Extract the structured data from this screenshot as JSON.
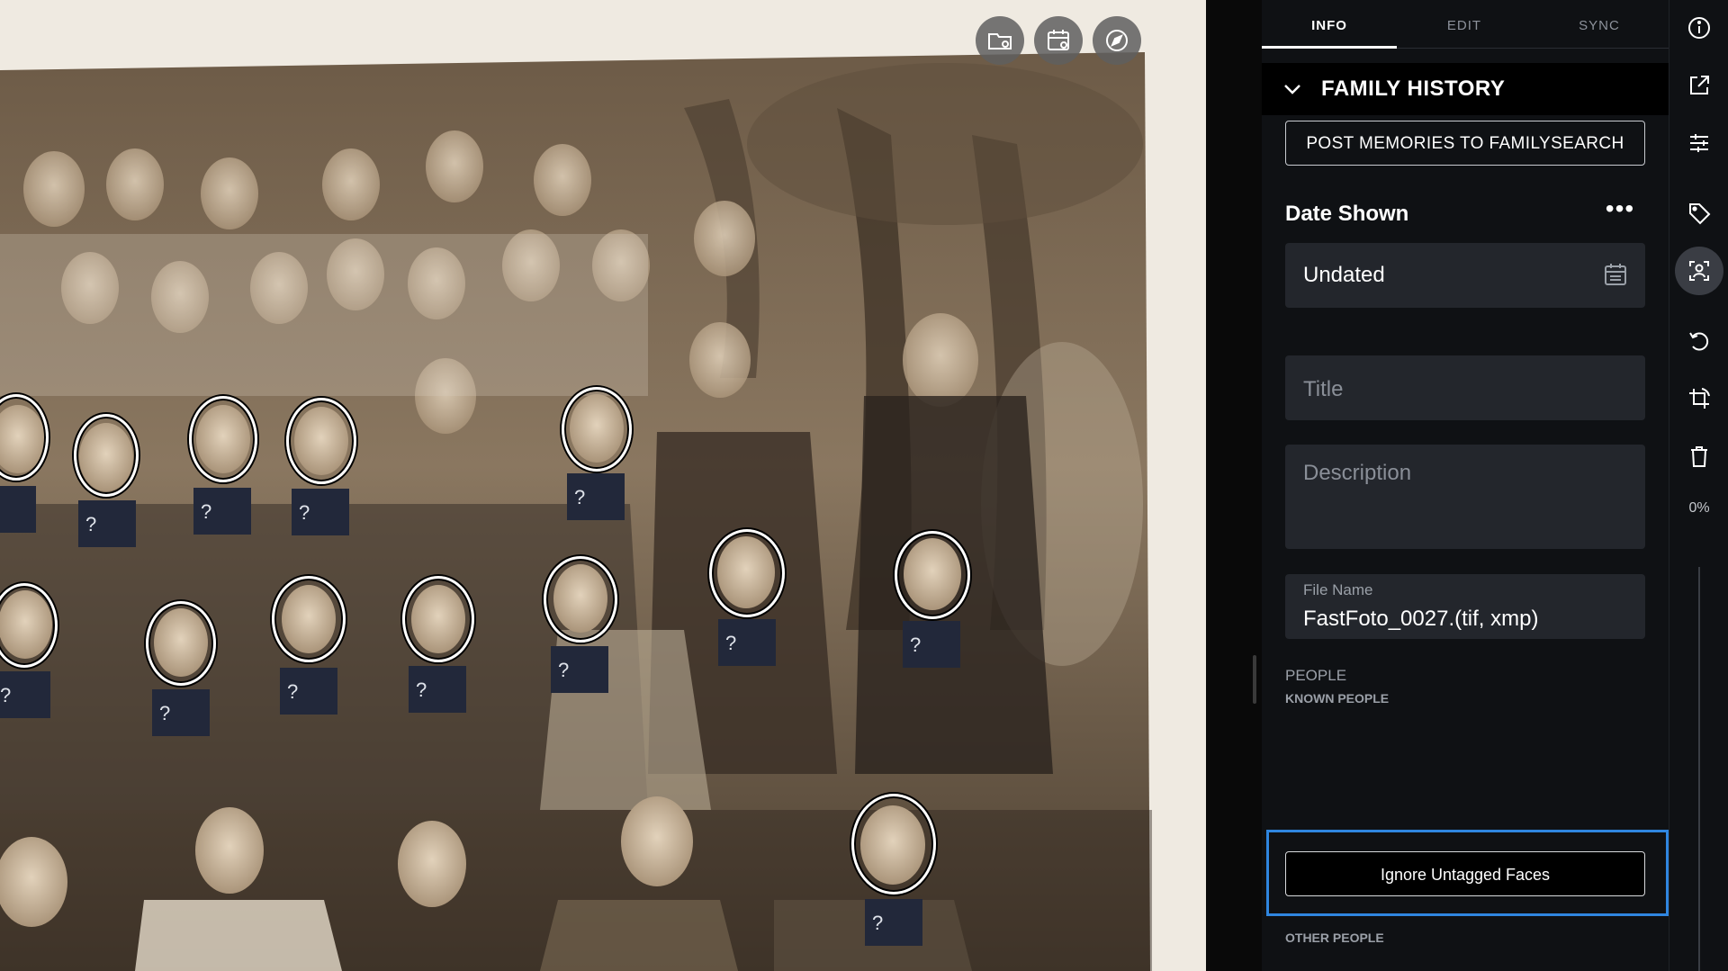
{
  "photo": {
    "toolbar": [
      {
        "name": "folder-view-icon"
      },
      {
        "name": "calendar-view-icon"
      },
      {
        "name": "compass-icon"
      }
    ],
    "faces": [
      {
        "name": "face-tag-1",
        "label": "?"
      },
      {
        "name": "face-tag-2",
        "label": "?"
      },
      {
        "name": "face-tag-3",
        "label": "?"
      },
      {
        "name": "face-tag-4",
        "label": "?"
      },
      {
        "name": "face-tag-5",
        "label": "?"
      },
      {
        "name": "face-tag-6",
        "label": "?"
      },
      {
        "name": "face-tag-7",
        "label": "?"
      },
      {
        "name": "face-tag-8",
        "label": "?"
      },
      {
        "name": "face-tag-9",
        "label": "?"
      },
      {
        "name": "face-tag-10",
        "label": "?"
      },
      {
        "name": "face-tag-11",
        "label": "?"
      },
      {
        "name": "face-tag-12",
        "label": "?"
      },
      {
        "name": "face-tag-13",
        "label": "?"
      },
      {
        "name": "face-tag-14",
        "label": "?"
      }
    ]
  },
  "tabs": [
    {
      "label": "INFO",
      "active": true
    },
    {
      "label": "EDIT",
      "active": false
    },
    {
      "label": "SYNC",
      "active": false
    }
  ],
  "section": {
    "title": "FAMILY HISTORY",
    "post_button": "POST MEMORIES TO FAMILYSEARCH"
  },
  "date": {
    "label": "Date Shown",
    "more": "•••",
    "value": "Undated"
  },
  "fields": {
    "title_placeholder": "Title",
    "description_placeholder": "Description",
    "file_name_caption": "File Name",
    "file_name_value": "FastFoto_0027.(tif, xmp)"
  },
  "people": {
    "label": "PEOPLE",
    "known_label": "KNOWN PEOPLE",
    "ignore_button": "Ignore Untagged Faces",
    "other_label": "OTHER PEOPLE"
  },
  "rail": {
    "icons": [
      "info-icon",
      "open-external-icon",
      "adjustments-icon",
      "tag-icon",
      "face-recognition-icon",
      "rotate-icon",
      "crop-rotate-icon",
      "trash-icon"
    ],
    "active_icon": "face-recognition-icon",
    "zoom": "0%"
  },
  "colors": {
    "panel_bg": "#0f1114",
    "field_bg": "#23262c",
    "focus_outline": "#2f86e0",
    "face_tag_bg": "#22283a"
  }
}
